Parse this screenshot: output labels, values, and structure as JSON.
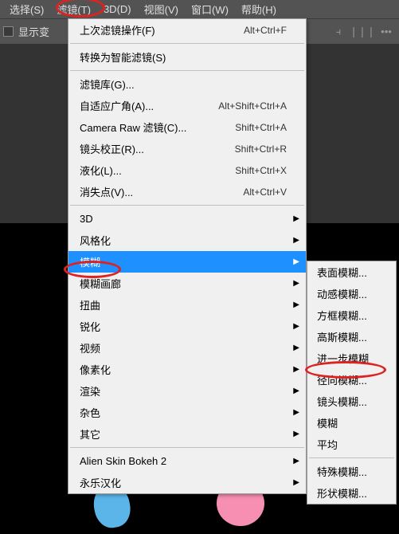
{
  "menubar": {
    "items": [
      "选择(S)",
      "滤镜(T)",
      "3D(D)",
      "视图(V)",
      "窗口(W)",
      "帮助(H)"
    ]
  },
  "toolbar": {
    "checkbox_label": "显示变"
  },
  "dropdown": {
    "last_filter": {
      "label": "上次滤镜操作(F)",
      "shortcut": "Alt+Ctrl+F"
    },
    "smart": "转换为智能滤镜(S)",
    "group1": [
      {
        "label": "滤镜库(G)...",
        "shortcut": ""
      },
      {
        "label": "自适应广角(A)...",
        "shortcut": "Alt+Shift+Ctrl+A"
      },
      {
        "label": "Camera Raw 滤镜(C)...",
        "shortcut": "Shift+Ctrl+A"
      },
      {
        "label": "镜头校正(R)...",
        "shortcut": "Shift+Ctrl+R"
      },
      {
        "label": "液化(L)...",
        "shortcut": "Shift+Ctrl+X"
      },
      {
        "label": "消失点(V)...",
        "shortcut": "Alt+Ctrl+V"
      }
    ],
    "group2": [
      {
        "label": "3D"
      },
      {
        "label": "风格化"
      },
      {
        "label": "模糊",
        "highlight": true
      },
      {
        "label": "模糊画廊"
      },
      {
        "label": "扭曲"
      },
      {
        "label": "锐化"
      },
      {
        "label": "视频"
      },
      {
        "label": "像素化"
      },
      {
        "label": "渲染"
      },
      {
        "label": "杂色"
      },
      {
        "label": "其它"
      }
    ],
    "group3": [
      {
        "label": "Alien Skin Bokeh 2"
      },
      {
        "label": "永乐汉化"
      }
    ]
  },
  "submenu": {
    "items1": [
      "表面模糊...",
      "动感模糊...",
      "方框模糊...",
      "高斯模糊...",
      "进一步模糊",
      "径向模糊...",
      "镜头模糊...",
      "模糊",
      "平均"
    ],
    "items2": [
      "特殊模糊...",
      "形状模糊..."
    ]
  }
}
